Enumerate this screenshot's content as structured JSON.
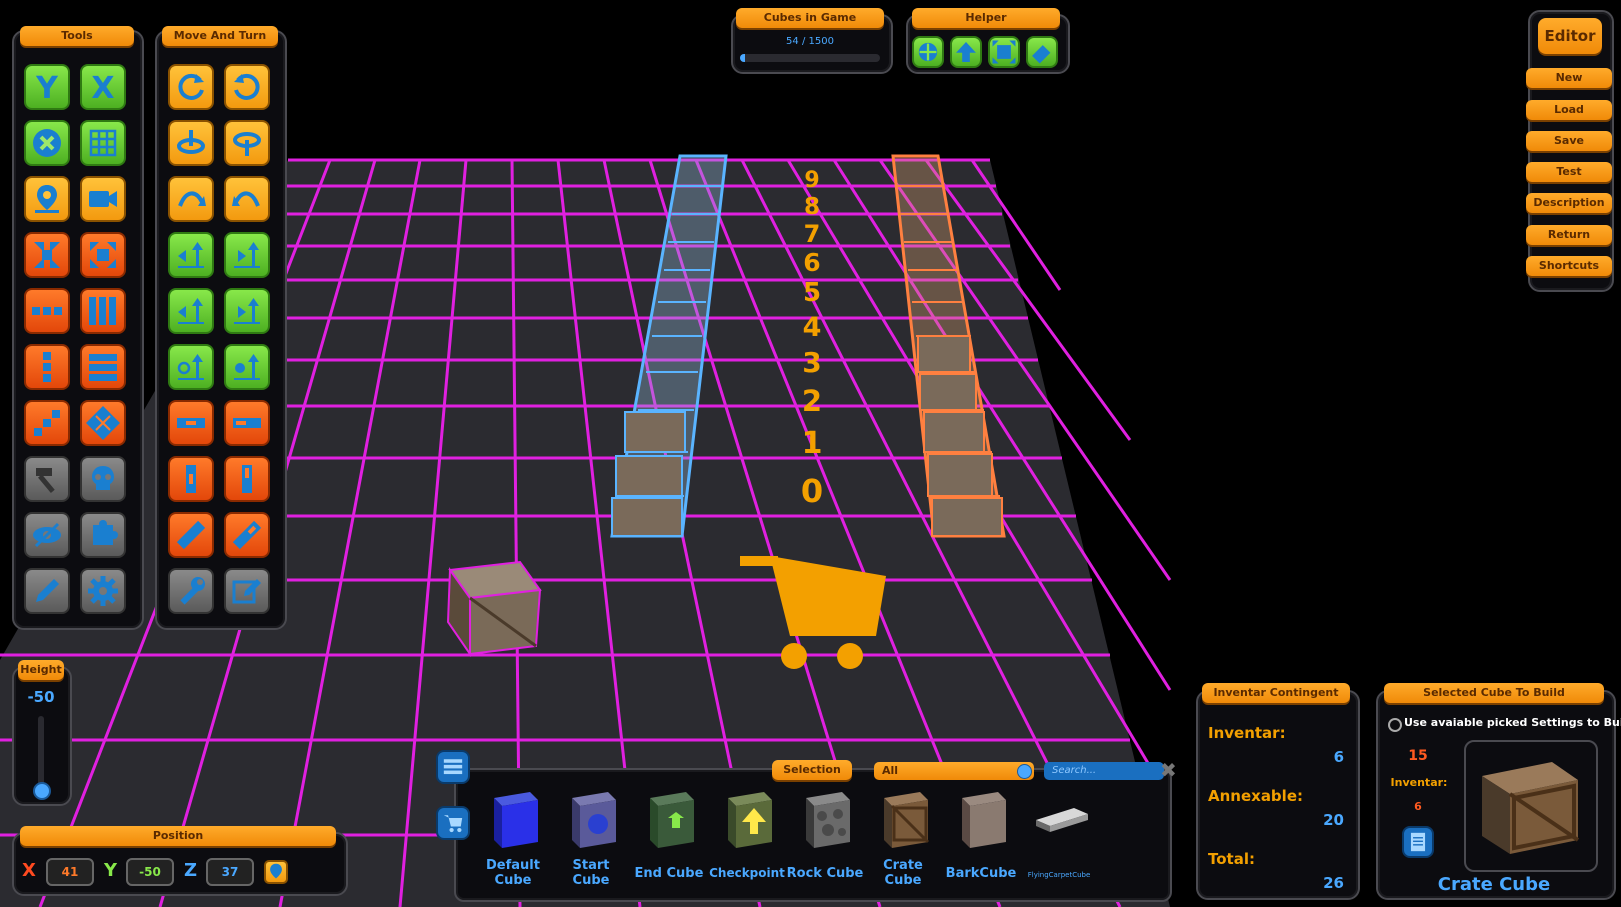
{
  "tools_panel": {
    "title": "Tools"
  },
  "move_panel": {
    "title": "Move And Turn"
  },
  "cubes_in_game": {
    "title": "Cubes in Game",
    "count_text": "54 / 1500",
    "progress": 0.036
  },
  "helper_panel": {
    "title": "Helper"
  },
  "editor_panel": {
    "title": "Editor",
    "buttons": [
      "New",
      "Load",
      "Save",
      "Test",
      "Description",
      "Return",
      "Shortcuts"
    ]
  },
  "height_panel": {
    "title": "Height",
    "value": "-50"
  },
  "position_panel": {
    "title": "Position",
    "x_label": "X",
    "x_value": "41",
    "y_label": "Y",
    "y_value": "-50",
    "z_label": "Z",
    "z_value": "37"
  },
  "selection_bar": {
    "title": "Selection",
    "filter_value": "All",
    "search_placeholder": "Search...",
    "cubes": [
      {
        "line1": "Default",
        "line2": "Cube"
      },
      {
        "line1": "Start",
        "line2": "Cube"
      },
      {
        "line1": "End Cube",
        "line2": ""
      },
      {
        "line1": "Checkpoint",
        "line2": ""
      },
      {
        "line1": "Rock Cube",
        "line2": ""
      },
      {
        "line1": "Crate",
        "line2": "Cube"
      },
      {
        "line1": "BarkCube",
        "line2": ""
      },
      {
        "line1": "FlyingCarpetCube",
        "line2": ""
      }
    ]
  },
  "inventar_contingent": {
    "title": "Inventar Contingent",
    "inventar_label": "Inventar:",
    "inventar_value": "6",
    "annexable_label": "Annexable:",
    "annexable_value": "20",
    "total_label": "Total:",
    "total_value": "26"
  },
  "selected_cube": {
    "title": "Selected Cube To Build",
    "checkbox_label": "Use avaiable picked Settings to Build",
    "count": "15",
    "inventar_label": "Inventar:",
    "inventar_value": "6",
    "name": "Crate Cube"
  },
  "scene_numbers": [
    "9",
    "8",
    "7",
    "6",
    "5",
    "4",
    "3",
    "2",
    "1",
    "0"
  ],
  "colors": {
    "accent": "#f39a0f",
    "grid": "#e020e0",
    "blue_text": "#4aa8ff",
    "floor": "#2a2a2e"
  }
}
